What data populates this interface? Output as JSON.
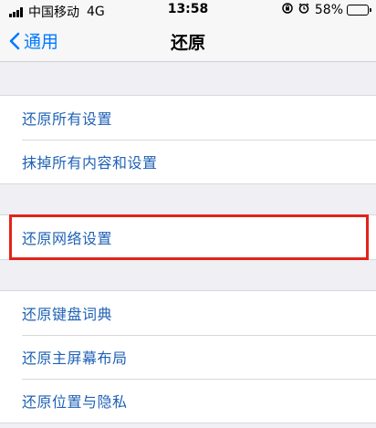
{
  "status_bar": {
    "carrier": "中国移动",
    "network": "4G",
    "time": "13:58",
    "battery_percent": "58%",
    "battery_level": 0.58,
    "icons": [
      "signal-icon",
      "lock-rotation-icon",
      "alarm-icon",
      "battery-icon"
    ]
  },
  "nav": {
    "back_label": "通用",
    "title": "还原"
  },
  "groups": [
    {
      "items": [
        "还原所有设置",
        "抹掉所有内容和设置"
      ]
    },
    {
      "items": [
        "还原网络设置"
      ]
    },
    {
      "items": [
        "还原键盘词典",
        "还原主屏幕布局",
        "还原位置与隐私"
      ]
    }
  ],
  "colors": {
    "link": "#1f62b5",
    "nav_accent": "#007aff",
    "highlight_border": "#e2231a",
    "background": "#efeff4"
  }
}
